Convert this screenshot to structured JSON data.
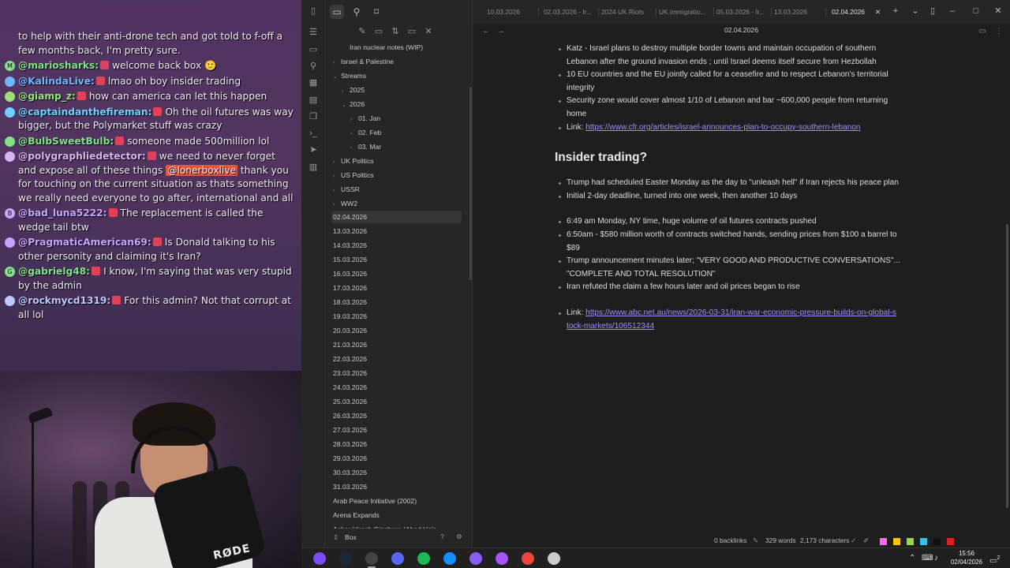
{
  "chat": {
    "first_line": "to help with their anti-drone tech and got told to f-off a few months back, I'm pretty sure.",
    "messages": [
      {
        "user": "@mariosharks:",
        "text": "welcome back box 🙂",
        "color": "#7fe28a",
        "badge": "M"
      },
      {
        "user": "@KalindaLive:",
        "text": "lmao oh boy insider trading",
        "color": "#6fb6ff",
        "badge": ""
      },
      {
        "user": "@giamp_z:",
        "text": "how can america can let this happen",
        "color": "#9be07a",
        "badge": ""
      },
      {
        "user": "@captaindanthefireman:",
        "text": "Oh the oil futures was way bigger, but the Polymarket stuff was crazy",
        "color": "#6fd0ff",
        "badge": ""
      },
      {
        "user": "@BulbSweetBulb:",
        "text": "someone made 500million lol",
        "color": "#7fe28a",
        "badge": ""
      },
      {
        "user": "@polygraphliedetector:",
        "text_before": "we need to never forget and expose all of these things",
        "mention": "@lonerboxlive",
        "text_after": "thank you for touching on the current situation as thats something we really need everyone to go after, international and all",
        "color": "#d9b3f2",
        "badge": ""
      },
      {
        "user": "@bad_luna5222:",
        "text": "The replacement is called the wedge tail btw",
        "color": "#c6a7ff",
        "badge": "B"
      },
      {
        "user": "@PragmaticAmerican69:",
        "text": "Is Donald talking to his other personity and claiming it's Iran?",
        "color": "#c9a3ff",
        "badge": ""
      },
      {
        "user": "@gabrielg48:",
        "text": "I know, I'm saying that was very stupid by the admin",
        "color": "#7fe28a",
        "badge": "G"
      },
      {
        "user": "@rockmycd1319:",
        "text": "For this admin? Not that corrupt at all lol",
        "color": "#bfc9ff",
        "badge": ""
      }
    ]
  },
  "webcam": {
    "mic_brand": "RØDE"
  },
  "sidebar": {
    "tree": [
      {
        "label": "Iran nuclear notes (WIP)",
        "indent": 1,
        "chev": ""
      },
      {
        "label": "Israel & Palestine",
        "indent": 0,
        "chev": "›"
      },
      {
        "label": "Streams",
        "indent": 0,
        "chev": "⌄"
      },
      {
        "label": "2025",
        "indent": 1,
        "chev": "›"
      },
      {
        "label": "2026",
        "indent": 1,
        "chev": "⌄"
      },
      {
        "label": "01. Jan",
        "indent": 2,
        "chev": "›"
      },
      {
        "label": "02. Feb",
        "indent": 2,
        "chev": "›"
      },
      {
        "label": "03. Mar",
        "indent": 2,
        "chev": "›"
      },
      {
        "label": "UK Politics",
        "indent": 0,
        "chev": "›"
      },
      {
        "label": "US Politics",
        "indent": 0,
        "chev": "›"
      },
      {
        "label": "USSR",
        "indent": 0,
        "chev": "›"
      },
      {
        "label": "WW2",
        "indent": 0,
        "chev": "›"
      },
      {
        "label": "02.04.2026",
        "indent": 0,
        "chev": "",
        "selected": true
      },
      {
        "label": "13.03.2026",
        "indent": 0,
        "chev": ""
      },
      {
        "label": "14.03.2026",
        "indent": 0,
        "chev": ""
      },
      {
        "label": "15.03.2026",
        "indent": 0,
        "chev": ""
      },
      {
        "label": "16.03.2026",
        "indent": 0,
        "chev": ""
      },
      {
        "label": "17.03.2026",
        "indent": 0,
        "chev": ""
      },
      {
        "label": "18.03.2026",
        "indent": 0,
        "chev": ""
      },
      {
        "label": "19.03.2026",
        "indent": 0,
        "chev": ""
      },
      {
        "label": "20.03.2026",
        "indent": 0,
        "chev": ""
      },
      {
        "label": "21.03.2026",
        "indent": 0,
        "chev": ""
      },
      {
        "label": "22.03.2026",
        "indent": 0,
        "chev": ""
      },
      {
        "label": "23.03.2026",
        "indent": 0,
        "chev": ""
      },
      {
        "label": "24.03.2026",
        "indent": 0,
        "chev": ""
      },
      {
        "label": "25.03.2026",
        "indent": 0,
        "chev": ""
      },
      {
        "label": "26.03.2026",
        "indent": 0,
        "chev": ""
      },
      {
        "label": "27.03.2026",
        "indent": 0,
        "chev": ""
      },
      {
        "label": "28.03.2026",
        "indent": 0,
        "chev": ""
      },
      {
        "label": "29.03.2026",
        "indent": 0,
        "chev": ""
      },
      {
        "label": "30.03.2026",
        "indent": 0,
        "chev": ""
      },
      {
        "label": "31.03.2026",
        "indent": 0,
        "chev": ""
      },
      {
        "label": "Arab Peace Initiative (2002)",
        "indent": 0,
        "chev": ""
      },
      {
        "label": "Arena Expands",
        "indent": 0,
        "chev": ""
      },
      {
        "label": "Asher Hirsch Ginsberg (Ahad Ha'a...",
        "indent": 0,
        "chev": ""
      }
    ],
    "vault_name": "Box"
  },
  "tabs": [
    {
      "label": "10.03.2026",
      "active": false
    },
    {
      "label": "02.03.2026 - Ir...",
      "active": false
    },
    {
      "label": "2024 UK Riots",
      "active": false
    },
    {
      "label": "UK immigratio...",
      "active": false
    },
    {
      "label": "05.03.2026 - Ir...",
      "active": false
    },
    {
      "label": "13.03.2026",
      "active": false
    },
    {
      "label": "02.04.2026",
      "active": true
    }
  ],
  "note": {
    "title": "02.04.2026",
    "top_bullets": [
      {
        "lines": [
          "Katz - Israel plans to destroy multiple border towns and maintain occupation of southern",
          "Lebanon after the ground invasion ends ; until Israel deems itself secure from Hezbollah"
        ]
      },
      {
        "lines": [
          "10 EU countries and the EU jointly called for a ceasefire and to respect Lebanon's territorial",
          "integrity"
        ]
      },
      {
        "lines": [
          "Security zone would cover almost 1/10 of Lebanon and bar ~600,000 people from returning",
          "home"
        ]
      }
    ],
    "link1_prefix": "Link: ",
    "link1": "https://www.cfr.org/articles/israel-announces-plan-to-occupy-southern-lebanon",
    "heading": "Insider trading?",
    "bullets_a": [
      "Trump had scheduled Easter Monday as the day to \"unleash hell\" if Iran rejects his peace plan",
      "Initial 2-day deadline, turned into one week, then another 10 days"
    ],
    "bullets_b": [
      {
        "lines": [
          "6:49 am Monday, NY time, huge volume of oil futures contracts pushed"
        ]
      },
      {
        "lines": [
          "6:50am - $580 million worth of contracts switched hands, sending prices from $100 a barrel to",
          "$89"
        ]
      },
      {
        "lines": [
          "Trump announcement minutes later; \"VERY GOOD AND PRODUCTIVE CONVERSATIONS\"...",
          "\"COMPLETE AND TOTAL RESOLUTION\""
        ]
      },
      {
        "lines": [
          "Iran refuted the claim a few hours later and oil prices began to rise"
        ]
      }
    ],
    "link2_prefix": "Link: ",
    "link2_line1": "https://www.abc.net.au/news/2026-03-31/iran-war-economic-pressure-builds-on-global-s",
    "link2_line2": "tock-markets/106512344"
  },
  "status": {
    "backlinks": "0 backlinks",
    "words": "329 words",
    "characters": "2,173 characters",
    "swatches": [
      "#ff69e6",
      "#f5c400",
      "#9ad64a",
      "#33c2e6",
      "#111111",
      "#e02020"
    ]
  },
  "taskbar": {
    "time": "15:56",
    "date": "02/04/2026",
    "notification_count": "2",
    "icons": [
      {
        "name": "obsidian-taskbar-icon",
        "color": "#7c4dff"
      },
      {
        "name": "steam-taskbar-icon",
        "color": "#1b2838"
      },
      {
        "name": "obs-taskbar-icon",
        "color": "#444444"
      },
      {
        "name": "discord-taskbar-icon",
        "color": "#5865f2"
      },
      {
        "name": "spotify-taskbar-icon",
        "color": "#1db954"
      },
      {
        "name": "battlenet-taskbar-icon",
        "color": "#148eff"
      },
      {
        "name": "obsidian-alt-taskbar-icon",
        "color": "#8b5cf6"
      },
      {
        "name": "messenger-taskbar-icon",
        "color": "#a855f7"
      },
      {
        "name": "chrome-taskbar-icon",
        "color": "#e8453c"
      },
      {
        "name": "explorer-taskbar-icon",
        "color": "#cccccc"
      }
    ]
  }
}
